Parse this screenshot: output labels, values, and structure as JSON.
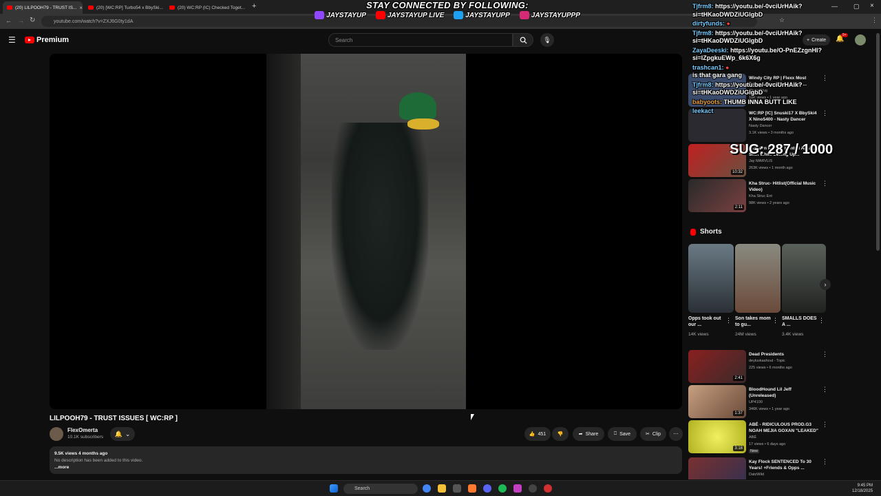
{
  "browser": {
    "tabs": [
      {
        "label": "(20) LILPOOH79 - TRUST IS..."
      },
      {
        "label": "(20) [WC:RP] Turbo54 x BbySki..."
      },
      {
        "label": "(20) WC:RP (IC) Checked Toget..."
      }
    ],
    "url": "youtube.com/watch?v=ZXJ6G0ty1dA",
    "new_tab": "+"
  },
  "overlay": {
    "banner": "STAY CONNECTED BY FOLLOWING:",
    "socials": [
      {
        "icon": "twitch-icon",
        "handle": "JAYSTAYUP",
        "color": "#9146ff"
      },
      {
        "icon": "youtube-icon",
        "handle": "JAYSTAYUP LIVE",
        "color": "#ff0000"
      },
      {
        "icon": "twitter-icon",
        "handle": "JAYSTAYUPP",
        "color": "#1da1f2"
      },
      {
        "icon": "instagram-icon",
        "handle": "JAYSTAYUPPP",
        "color": "#d62976"
      }
    ],
    "sug_counter": "SUG: 287 / 1000",
    "chat": [
      {
        "user": "Tjfrm8:",
        "text": "https://youtu.be/-0vciUrHAik?si=tHKaoDWDZiUGlgbD"
      },
      {
        "user": "dirtyfunds:",
        "text": ""
      },
      {
        "user": "Tjfrm8:",
        "text": "https://youtu.be/-0vciUrHAik?si=tHKaoDWDZiUGlgbD"
      },
      {
        "user": "ZayaDeeski:",
        "text": "https://youtu.be/O-PnEZzgnHI?si=lZpgkuEWp_6k6X6g"
      },
      {
        "user": "trashcan1:",
        "text": ""
      },
      {
        "user": "",
        "text": "is that gara gang"
      },
      {
        "user": "Tjfrm8:",
        "text": "https://youtu.be/-0vciUrHAik?si=tHKaoDWDZiUGlgbD"
      },
      {
        "user": "babyoots:",
        "text": "THUMB INNA BUTT LIKE"
      },
      {
        "user": "leekact",
        "text": ""
      }
    ]
  },
  "youtube": {
    "brand": "Premium",
    "search_placeholder": "Search",
    "create_label": "Create",
    "notif_count": "9+",
    "video": {
      "title": "LILPOOH79 - TRUST ISSUES [ WC:RP ]",
      "channel": "FlexOmerta",
      "subscribers": "10.1K subscribers",
      "likes": "451",
      "share": "Share",
      "save": "Save",
      "clip": "Clip",
      "views_age": "9.5K views  4 months ago",
      "description": "No description has been added to this video.",
      "more": "...more"
    },
    "sidebar": [
      {
        "title": "Windy City RP | Flexx Most Demon Time Moments in ...",
        "channel": "Chain Plug",
        "meta": "18K views • 1 year ago",
        "duration": "",
        "thumb": "#3a4a6a"
      },
      {
        "title": "WC:RP [IC] Snuski17 X BbySki4 X Nino5400 - Nasty Dancer",
        "channel": "Nasty Dancer",
        "meta": "3.1K views • 3 months ago",
        "duration": "",
        "thumb": "#2a2a30"
      },
      {
        "title": "Jackson Ranch: Hunted Again... Shot While Setting Up...",
        "channel": "Jay MARVLIS",
        "meta": "263K views • 1 month ago",
        "duration": "10:32",
        "thumb": "#8a2a2a"
      },
      {
        "title": "Kha Struc- Hitlist(Official Music Video)",
        "channel": "Kha Struc Ent",
        "meta": "98K views • 2 years ago",
        "duration": "2:11",
        "thumb": "#5a3030"
      }
    ],
    "shorts_title": "Shorts",
    "shorts": [
      {
        "title": "Opps took out our ...",
        "views": "14K views",
        "thumb": "#4a5560"
      },
      {
        "title": "Son takes mom to gu...",
        "views": "24M views",
        "thumb": "#7a6a5a"
      },
      {
        "title": "SMALLS DOES A ...",
        "views": "3.4K views",
        "thumb": "#3a3d3a"
      }
    ],
    "sidebar2": [
      {
        "title": "Dead Presidents",
        "channel": "deyluvkashout - Topic",
        "meta": "225 views • 6 months ago",
        "duration": "2:41",
        "thumb": "#7a2a2a",
        "badge": ""
      },
      {
        "title": "BloodHound Lil Jeff (Unreleased)",
        "channel": "UP4100",
        "meta": "346K views • 1 year ago",
        "duration": "1:37",
        "thumb": "#b89070",
        "badge": ""
      },
      {
        "title": "ABÉ - RIDICULOUS PROD.G3 NOAH MEJIA GOXAN \"LEAKED\"",
        "channel": "ABÉ",
        "meta": "17 views • 6 days ago",
        "duration": "3:18",
        "thumb": "#d6d640",
        "badge": "New"
      },
      {
        "title": "Kay Flock SENTENCED To 30 Years! +Friends & Opps ...",
        "channel": "DatzWild",
        "meta": "",
        "duration": "",
        "thumb": "#6a3030",
        "badge": ""
      }
    ]
  },
  "taskbar": {
    "search": "Search",
    "time": "9:45 PM",
    "date": "12/18/2025"
  }
}
